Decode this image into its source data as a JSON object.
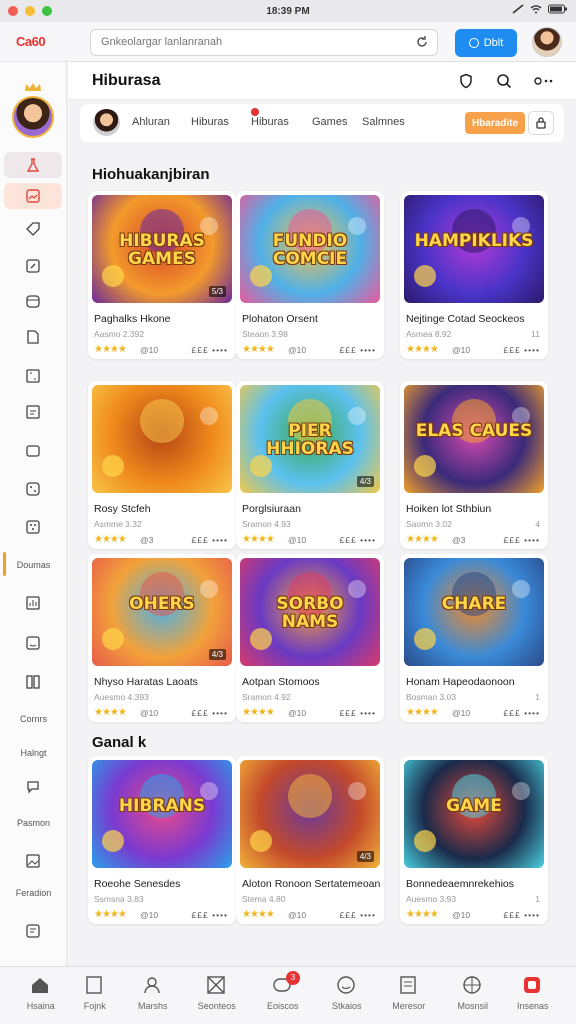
{
  "status_bar": {
    "time": "18:39 PM"
  },
  "browser": {
    "logo": "Ca60",
    "url_text": "Gnkeolargar lanlanranah",
    "cta_label": "Dblt"
  },
  "header": {
    "title": "Hiburasa"
  },
  "tabs": [
    "Ahluran",
    "Hiburas",
    "Hiburas",
    "Games",
    "Salmnes"
  ],
  "tabs_pill": "Hbaradite",
  "sections": {
    "main": "Hiohuakanjbiran",
    "second": "Ganal k"
  },
  "sidebar": {
    "labels": [
      "Doumas",
      "Cornrs",
      "Halngt",
      "Pasmon",
      "Feradion"
    ]
  },
  "cards": [
    {
      "title": "Paghalks Hkone",
      "sub": "Aasmo 2.392",
      "num": "",
      "rating": "@10",
      "meta": "£££ ••••",
      "art": "HIBURAS GAMES",
      "badge": "5/3"
    },
    {
      "title": "Plohaton Orsent",
      "sub": "Steaon 3.98",
      "num": "",
      "rating": "@10",
      "meta": "£££ ••••",
      "art": "FUNDIO COMCIE",
      "badge": ""
    },
    {
      "title": "Nejtinge Cotad Seockeos",
      "sub": "Asmea 8.92",
      "num": "11",
      "rating": "@10",
      "meta": "£££ ••••",
      "art": "HAMPIKLIKS",
      "badge": ""
    },
    {
      "title": "Rosy Stcfeh",
      "sub": "Asmme 3.32",
      "num": "",
      "rating": "@3",
      "meta": "£££ ••••",
      "art": "",
      "badge": ""
    },
    {
      "title": "Porglsiuraan",
      "sub": "Sramon 4.93",
      "num": "",
      "rating": "@10",
      "meta": "£££ ••••",
      "art": "PIER HHIORAS",
      "badge": "4/3"
    },
    {
      "title": "Hoiken lot Sthbiun",
      "sub": "Saomn 3.02",
      "num": "4",
      "rating": "@3",
      "meta": "£££ ••••",
      "art": "ELAS CAUES",
      "badge": ""
    },
    {
      "title": "Nhyso Haratas Laoats",
      "sub": "Auesmo 4.393",
      "num": "",
      "rating": "@10",
      "meta": "£££ ••••",
      "art": "OHERS",
      "badge": "4/3"
    },
    {
      "title": "Aotpan Stomoos",
      "sub": "Sramon 4.92",
      "num": "",
      "rating": "@10",
      "meta": "£££ ••••",
      "art": "SORBO NAMS",
      "badge": ""
    },
    {
      "title": "Honam Hapeodaonoon",
      "sub": "Bosman 3.03",
      "num": "1",
      "rating": "@10",
      "meta": "£££ ••••",
      "art": "CHARE",
      "badge": ""
    },
    {
      "title": "Roeohe Senesdes",
      "sub": "Ssmsna 3.83",
      "num": "",
      "rating": "@10",
      "meta": "£££ ••••",
      "art": "HIBRANS",
      "badge": ""
    },
    {
      "title": "Aloton Ronoon Sertatemeoan",
      "sub": "Stema 4.80",
      "num": "",
      "rating": "@10",
      "meta": "£££ ••••",
      "art": "",
      "badge": "4/3"
    },
    {
      "title": "Bonnedeaemnrekehios",
      "sub": "Auesmo 3.93",
      "num": "1",
      "rating": "@10",
      "meta": "£££ ••••",
      "art": "GAME",
      "badge": ""
    }
  ],
  "bottom_nav": [
    {
      "label": "Hsaina",
      "icon": "home-icon"
    },
    {
      "label": "Fojnk",
      "icon": "page-icon"
    },
    {
      "label": "Marshs",
      "icon": "user-icon"
    },
    {
      "label": "Seonteos",
      "icon": "box-icon"
    },
    {
      "label": "Eoiscos",
      "icon": "chat-icon",
      "badge": "3"
    },
    {
      "label": "Stkaios",
      "icon": "smile-icon"
    },
    {
      "label": "Meresor",
      "icon": "doc-icon"
    },
    {
      "label": "Mosnsil",
      "icon": "ball-icon"
    },
    {
      "label": "Insenas",
      "icon": "app-icon"
    },
    {
      "label": "Insenas",
      "icon": "spacer"
    }
  ],
  "colors": {
    "accent_blue": "#1f8cf2",
    "accent_orange": "#f7a24a",
    "brand_red": "#e8322e",
    "star": "#f3b51e"
  }
}
